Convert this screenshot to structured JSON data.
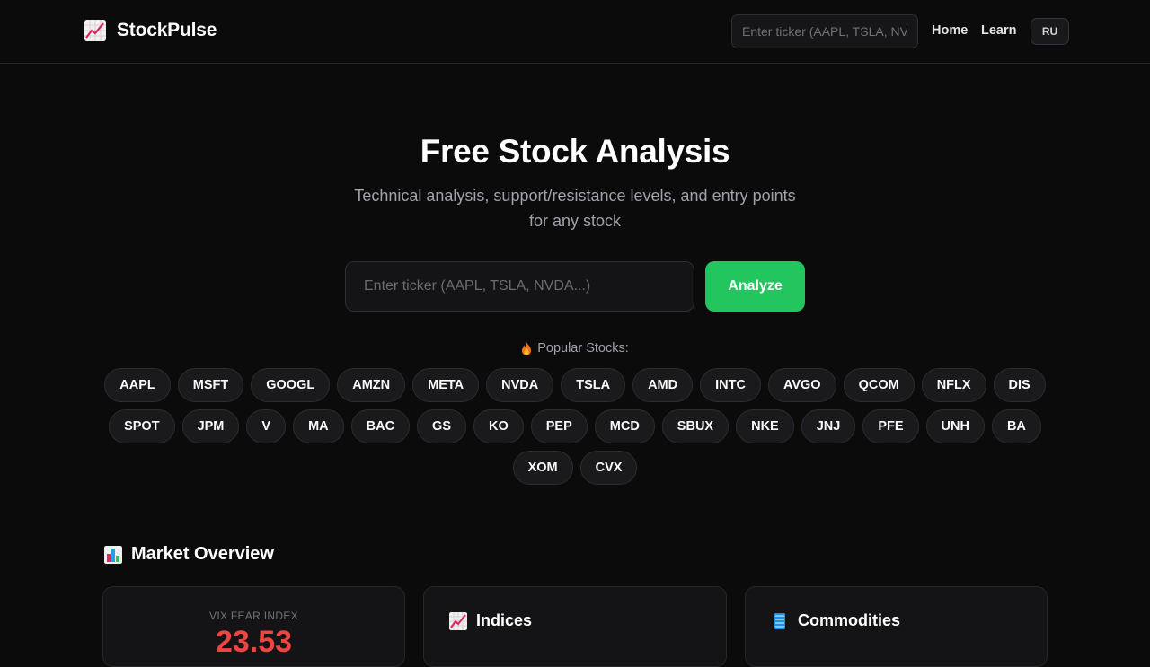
{
  "header": {
    "brand": "StockPulse",
    "search_placeholder": "Enter ticker (AAPL, TSLA, NVDA...)",
    "nav": {
      "home": "Home",
      "learn": "Learn"
    },
    "lang": "RU"
  },
  "hero": {
    "title": "Free Stock Analysis",
    "subtitle": "Technical analysis, support/resistance levels, and entry points for any stock",
    "search_placeholder": "Enter ticker (AAPL, TSLA, NVDA...)",
    "analyze_label": "Analyze"
  },
  "popular": {
    "label": "Popular Stocks:",
    "tickers": [
      "AAPL",
      "MSFT",
      "GOOGL",
      "AMZN",
      "META",
      "NVDA",
      "TSLA",
      "AMD",
      "INTC",
      "AVGO",
      "QCOM",
      "NFLX",
      "DIS",
      "SPOT",
      "JPM",
      "V",
      "MA",
      "BAC",
      "GS",
      "KO",
      "PEP",
      "MCD",
      "SBUX",
      "NKE",
      "JNJ",
      "PFE",
      "UNH",
      "BA",
      "XOM",
      "CVX"
    ]
  },
  "market": {
    "title": "Market Overview",
    "vix_label": "VIX FEAR INDEX",
    "vix_value": "23.53",
    "indices_title": "Indices",
    "commodities_title": "Commodities"
  },
  "icons": {
    "logo": "chart-increasing-icon",
    "popular": "fire-icon",
    "market": "bar-chart-icon",
    "indices": "chart-increasing-icon",
    "commodities": "ledger-icon"
  },
  "colors": {
    "accent": "#22c55e",
    "vix": "#ef4444",
    "background": "#0b0b0c"
  }
}
